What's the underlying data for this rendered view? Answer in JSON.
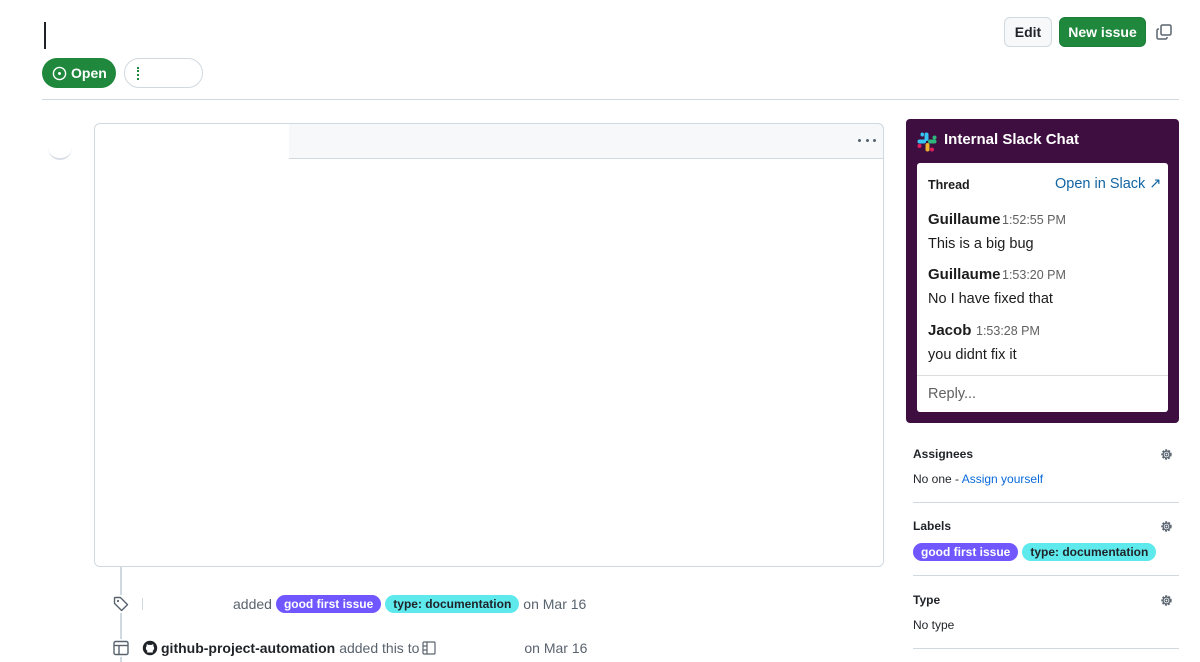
{
  "header": {
    "edit_label": "Edit",
    "new_issue_label": "New issue",
    "state_label": "Open"
  },
  "timeline": {
    "label_event": {
      "verb": "added",
      "labels": [
        "good first issue",
        "type: documentation"
      ],
      "date": "on Mar 16"
    },
    "project_event": {
      "actor": "github-project-automation",
      "verb": "added this to",
      "date": "on Mar 16"
    }
  },
  "slack": {
    "title": "Internal Slack Chat",
    "thread_label": "Thread",
    "open_link": "Open in Slack ↗",
    "messages": [
      {
        "author": "Guillaume",
        "time": "1:52:55 PM",
        "text": "This is a big bug"
      },
      {
        "author": "Guillaume",
        "time": "1:53:20 PM",
        "text": "No I have fixed that"
      },
      {
        "author": "Jacob",
        "time": "1:53:28 PM",
        "text": "you didnt fix it"
      }
    ],
    "reply_placeholder": "Reply..."
  },
  "sidebar": {
    "assignees": {
      "heading": "Assignees",
      "empty": "No one -",
      "assign_link": "Assign yourself"
    },
    "labels": {
      "heading": "Labels",
      "items": [
        "good first issue",
        "type: documentation"
      ]
    },
    "type": {
      "heading": "Type",
      "value": "No type"
    }
  },
  "colors": {
    "primary_green": "#1f883d",
    "slack_purple": "#3f0e40",
    "label_good_first_issue": "#7057ff",
    "label_documentation": "#5ee9ec",
    "link_blue": "#0969da"
  }
}
